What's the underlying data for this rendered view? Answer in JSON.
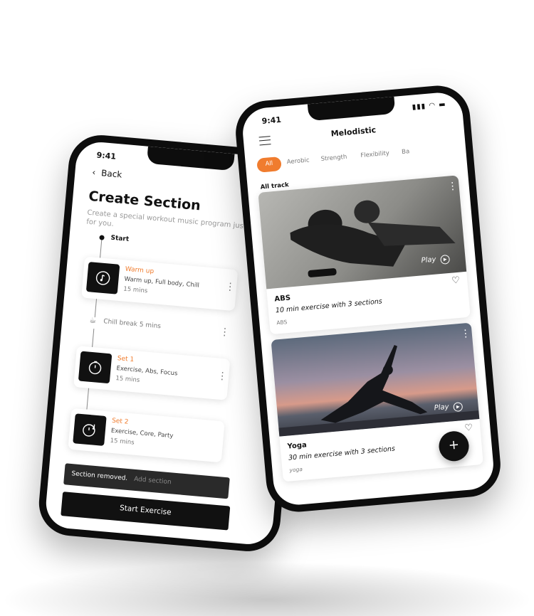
{
  "colors": {
    "accent": "#f07c2e",
    "dark": "#111111",
    "phone": "#0d0d0d"
  },
  "left_phone": {
    "status_time": "9:41",
    "back_label": "Back",
    "title": "Create Section",
    "subtitle": "Create a special workout music program just for you.",
    "start_label": "Start",
    "items": [
      {
        "title": "Warm up",
        "tags": "Warm up, Full body, Chill",
        "duration": "15 mins",
        "icon": "music-note-icon"
      },
      {
        "title": "Set 1",
        "tags": "Exercise, Abs, Focus",
        "duration": "15 mins",
        "icon": "timer-icon"
      },
      {
        "title": "Set 2",
        "tags": "Exercise, Core, Party",
        "duration": "15 mins",
        "icon": "music-timer-icon"
      }
    ],
    "break_label": "Chill break 5 mins",
    "toast_text": "Section removed.",
    "toast_action": "Add section",
    "start_button": "Start Exercise"
  },
  "right_phone": {
    "status_time": "9:41",
    "app_title": "Melodistic",
    "tabs": [
      "All",
      "Aerobic",
      "Strength",
      "Flexibility",
      "Ba"
    ],
    "active_tab": "All",
    "section_label": "All track",
    "cards": [
      {
        "title": "ABS",
        "subtitle": "10 min exercise with 3 sections",
        "tag": "ABS",
        "play": "Play"
      },
      {
        "title": "Yoga",
        "subtitle": "30 min exercise with 3 sections",
        "tag": "yoga",
        "play": "Play"
      }
    ],
    "fab_label": "+"
  }
}
